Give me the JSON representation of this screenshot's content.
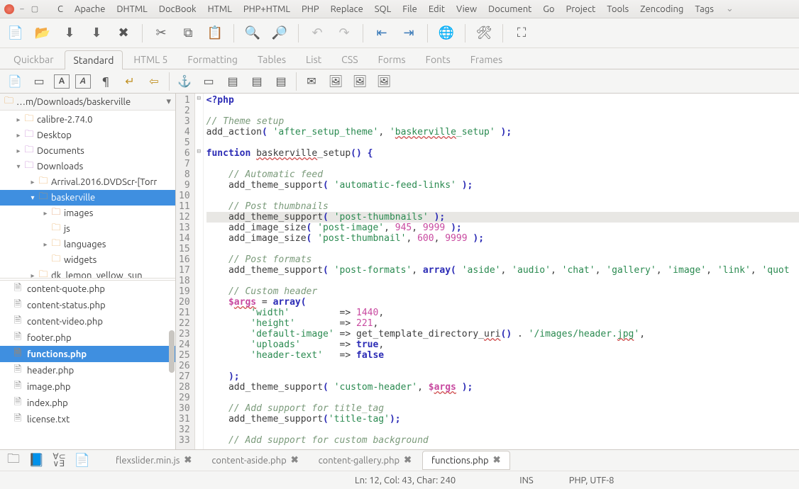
{
  "menus": [
    "C",
    "Apache",
    "DHTML",
    "DocBook",
    "HTML",
    "PHP+HTML",
    "PHP",
    "Replace",
    "SQL",
    "File",
    "Edit",
    "View",
    "Document",
    "Go",
    "Project",
    "Tools",
    "Zencoding",
    "Tags"
  ],
  "toolbar_tabs": [
    "Quickbar",
    "Standard",
    "HTML 5",
    "Formatting",
    "Tables",
    "List",
    "CSS",
    "Forms",
    "Fonts",
    "Frames"
  ],
  "toolbar_active": "Standard",
  "path": "…m/Downloads/baskerville",
  "tree": [
    {
      "level": 1,
      "tw": "▸",
      "icon": "folder",
      "label": "calibre-2.74.0"
    },
    {
      "level": 1,
      "tw": "▸",
      "icon": "folderp",
      "label": "Desktop"
    },
    {
      "level": 1,
      "tw": "▸",
      "icon": "folderp",
      "label": "Documents"
    },
    {
      "level": 1,
      "tw": "▾",
      "icon": "folderp",
      "label": "Downloads"
    },
    {
      "level": 2,
      "tw": "▸",
      "icon": "folder",
      "label": "Arrival.2016.DVDScr-[Torr"
    },
    {
      "level": 2,
      "tw": "▾",
      "icon": "folder",
      "label": "baskerville",
      "sel": true
    },
    {
      "level": 3,
      "tw": "▸",
      "icon": "folderimg",
      "label": "images"
    },
    {
      "level": 3,
      "tw": "",
      "icon": "folder",
      "label": "js"
    },
    {
      "level": 3,
      "tw": "▸",
      "icon": "folder",
      "label": "languages"
    },
    {
      "level": 3,
      "tw": "",
      "icon": "folder",
      "label": "widgets"
    },
    {
      "level": 2,
      "tw": "▸",
      "icon": "folder",
      "label": "dk_lemon_yellow_sun"
    }
  ],
  "files": [
    {
      "name": "content-quote.php"
    },
    {
      "name": "content-status.php"
    },
    {
      "name": "content-video.php"
    },
    {
      "name": "footer.php"
    },
    {
      "name": "functions.php",
      "sel": true
    },
    {
      "name": "header.php"
    },
    {
      "name": "image.php"
    },
    {
      "name": "index.php"
    },
    {
      "name": "license.txt"
    }
  ],
  "code": {
    "lines": [
      {
        "n": 1,
        "fold": "⊟",
        "html": "<span class='php'>&lt;?php</span>"
      },
      {
        "n": 2,
        "html": ""
      },
      {
        "n": 3,
        "html": "<span class='cm'>// Theme setup</span>"
      },
      {
        "n": 4,
        "html": "add_action<span class='kw'>(</span> <span class='str2'>'after_setup_theme'</span>, <span class='str2'>'<span class='und'>baskerville</span>_setup'</span> <span class='kw'>);</span>"
      },
      {
        "n": 5,
        "html": ""
      },
      {
        "n": 6,
        "fold": "⊟",
        "html": "<span class='kw'>function</span> <span class='und'>baskerville</span>_setup<span class='kw'>() {</span>"
      },
      {
        "n": 7,
        "html": ""
      },
      {
        "n": 8,
        "html": "    <span class='cm'>// Automatic feed</span>"
      },
      {
        "n": 9,
        "html": "    add_theme_support<span class='kw'>(</span> <span class='str2'>'automatic-feed-links'</span> <span class='kw'>);</span>"
      },
      {
        "n": 10,
        "html": ""
      },
      {
        "n": 11,
        "html": "    <span class='cm'>// Post thumbnails</span>"
      },
      {
        "n": 12,
        "hl": true,
        "html": "    add_theme_support<span class='kw'>(</span> <span class='str2'>'post-thumbnails'</span> <span class='kw'>);</span>"
      },
      {
        "n": 13,
        "html": "    add_image_size<span class='kw'>(</span> <span class='str2'>'post-image'</span>, <span class='num'>945</span>, <span class='num'>9999</span> <span class='kw'>);</span>"
      },
      {
        "n": 14,
        "html": "    add_image_size<span class='kw'>(</span> <span class='str2'>'post-thumbnail'</span>, <span class='num'>600</span>, <span class='num'>9999</span> <span class='kw'>);</span>"
      },
      {
        "n": 15,
        "html": ""
      },
      {
        "n": 16,
        "html": "    <span class='cm'>// Post formats</span>"
      },
      {
        "n": 17,
        "html": "    add_theme_support<span class='kw'>(</span> <span class='str2'>'post-formats'</span>, <span class='kw'>array(</span> <span class='str2'>'aside'</span>, <span class='str2'>'audio'</span>, <span class='str2'>'chat'</span>, <span class='str2'>'gallery'</span>, <span class='str2'>'image'</span>, <span class='str2'>'link'</span>, <span class='str2'>'quot</span>"
      },
      {
        "n": 18,
        "html": ""
      },
      {
        "n": 19,
        "html": "    <span class='cm'>// Custom header</span>"
      },
      {
        "n": 20,
        "html": "    <span class='var'>$<span class='und'>args</span></span> = <span class='kw'>array(</span>"
      },
      {
        "n": 21,
        "html": "        <span class='str2'>'width'</span>         =&gt; <span class='num'>1440</span>,"
      },
      {
        "n": 22,
        "html": "        <span class='str2'>'height'</span>        =&gt; <span class='num'>221</span>,"
      },
      {
        "n": 23,
        "html": "        <span class='str2'>'default-image'</span> =&gt; get_template_directory_<span class='und'>uri</span><span class='kw'>()</span> . <span class='str2'>'/images/header.<span class='und'>jpg</span>'</span>,"
      },
      {
        "n": 24,
        "html": "        <span class='str2'>'uploads'</span>       =&gt; <span class='kw'>true</span>,"
      },
      {
        "n": 25,
        "html": "        <span class='str2'>'header-text'</span>   =&gt; <span class='kw'>false</span>"
      },
      {
        "n": 26,
        "html": ""
      },
      {
        "n": 27,
        "html": "    <span class='kw'>);</span>"
      },
      {
        "n": 28,
        "html": "    add_theme_support<span class='kw'>(</span> <span class='str2'>'custom-header'</span>, <span class='var'>$<span class='und'>args</span></span> <span class='kw'>);</span>"
      },
      {
        "n": 29,
        "html": ""
      },
      {
        "n": 30,
        "html": "    <span class='cm'>// Add support for title_tag</span>"
      },
      {
        "n": 31,
        "html": "    add_theme_support<span class='kw'>(</span><span class='str2'>'title-tag'</span><span class='kw'>);</span>"
      },
      {
        "n": 32,
        "html": ""
      },
      {
        "n": 33,
        "html": "    <span class='cm'>// Add support for custom background</span>"
      }
    ]
  },
  "editor_tabs": [
    {
      "label": "flexslider.min.js",
      "close": true
    },
    {
      "label": "content-aside.php",
      "close": true
    },
    {
      "label": "content-gallery.php",
      "close": true
    },
    {
      "label": "functions.php",
      "close": true,
      "active": true
    }
  ],
  "status": {
    "pos": "Ln: 12, Col: 43, Char: 240",
    "ins": "INS",
    "mode": "PHP, UTF-8"
  }
}
